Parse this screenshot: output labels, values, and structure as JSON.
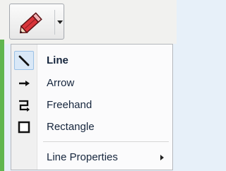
{
  "toolbar": {
    "tool_icon": "pencil-icon",
    "dropdown_icon": "chevron-down-icon"
  },
  "menu": {
    "items": [
      {
        "label": "Line",
        "icon": "line-icon",
        "selected": true
      },
      {
        "label": "Arrow",
        "icon": "arrow-icon",
        "selected": false
      },
      {
        "label": "Freehand",
        "icon": "freehand-icon",
        "selected": false
      },
      {
        "label": "Rectangle",
        "icon": "rectangle-icon",
        "selected": false
      }
    ],
    "properties": {
      "label": "Line Properties",
      "icon": "chevron-right-icon"
    }
  },
  "colors": {
    "accent_green": "#5fb64f",
    "pencil_red": "#d9343a",
    "selection_blue": "#d9e8f7"
  }
}
